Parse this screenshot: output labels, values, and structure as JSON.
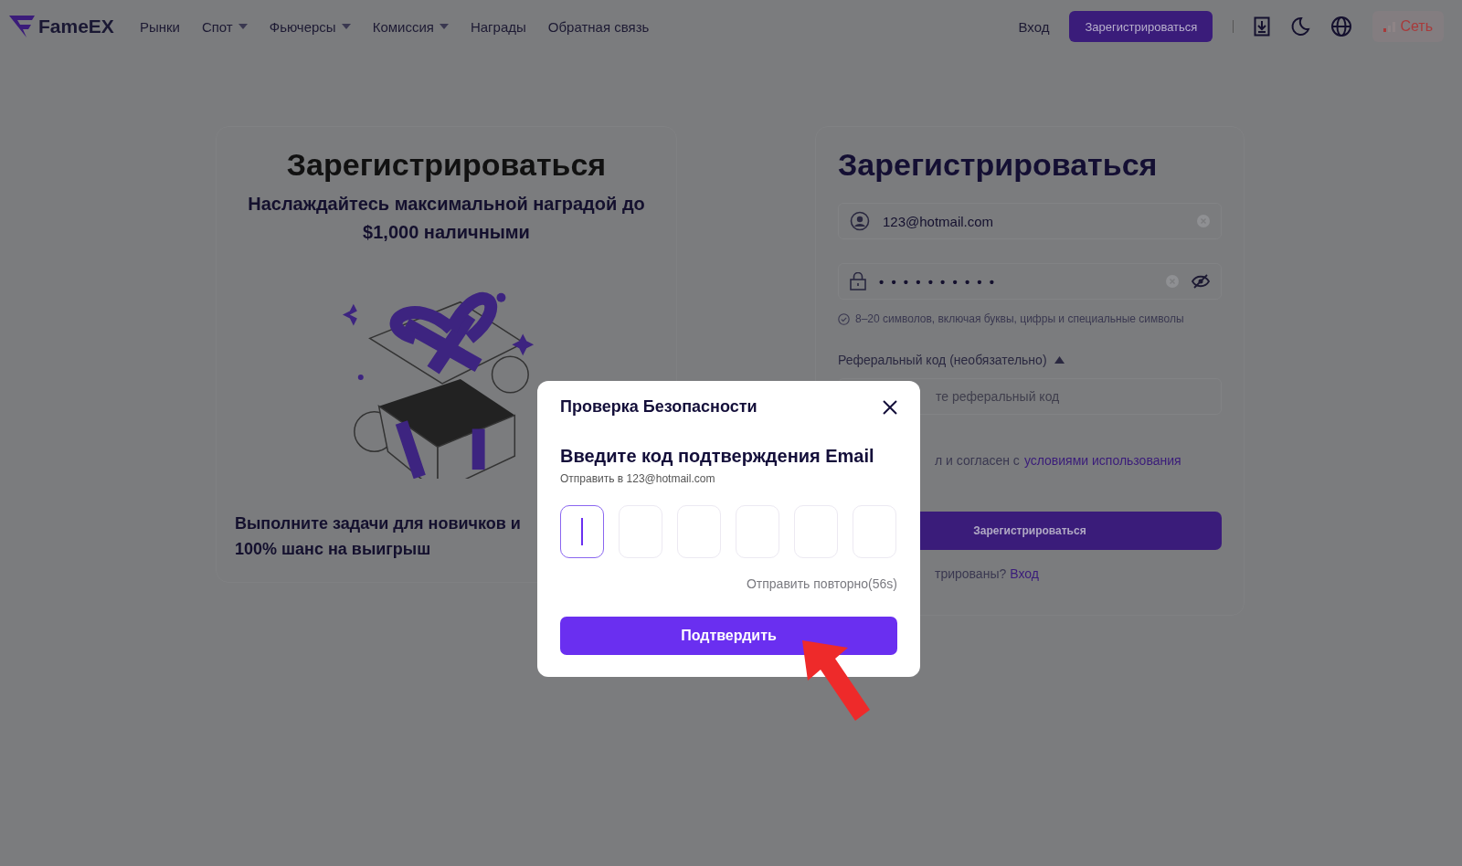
{
  "header": {
    "logo": "FameEX",
    "nav": [
      {
        "label": "Рынки",
        "dropdown": false
      },
      {
        "label": "Спот",
        "dropdown": true
      },
      {
        "label": "Фьючерсы",
        "dropdown": true
      },
      {
        "label": "Комиссия",
        "dropdown": true
      },
      {
        "label": "Награды",
        "dropdown": false
      },
      {
        "label": "Обратная связь",
        "dropdown": false
      }
    ],
    "login": "Вход",
    "register": "Зарегистрироваться",
    "network": "Сеть"
  },
  "promo": {
    "title": "Зарегистрироваться",
    "subtitle": "Наслаждайтесь максимальной наградой до $1,000 наличными",
    "tasks": "Выполните задачи для новичков и 100% шанс на выигрыш"
  },
  "form": {
    "title": "Зарегистрироваться",
    "email": "123@hotmail.com",
    "password_mask": "• • • • • • • • • •",
    "password_hint": "8–20 символов, включая буквы, цифры и специальные символы",
    "referral_label": "Реферальный код (необязательно)",
    "referral_expanded": true,
    "referral_placeholder": "те реферальный код",
    "agree_text": "л и согласен с",
    "agree_link": "условиями использования",
    "submit": "Зарегистрироваться",
    "login_prompt": "трированы?",
    "login_link": "Вход"
  },
  "modal": {
    "title": "Проверка Безопасности",
    "heading": "Введите код подтверждения Email",
    "sent_to": "Отправить в 123@hotmail.com",
    "code_boxes": [
      {
        "selected": true
      },
      {
        "selected": false
      },
      {
        "selected": false
      },
      {
        "selected": false
      },
      {
        "selected": false
      },
      {
        "selected": false
      }
    ],
    "resend": "Отправить повторно(56s)",
    "confirm": "Подтвердить"
  }
}
